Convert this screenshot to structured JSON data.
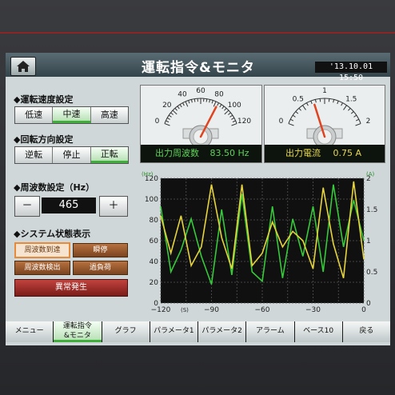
{
  "header": {
    "title": "運転指令&モニタ",
    "clock": "'13.10.01 15:50"
  },
  "speed": {
    "heading": "◆運転速度設定",
    "buttons": [
      "低速",
      "中速",
      "高速"
    ],
    "selected": 1
  },
  "direction": {
    "heading": "◆回転方向設定",
    "buttons": [
      "逆転",
      "停止",
      "正転"
    ],
    "selected": 2
  },
  "frequency": {
    "heading": "◆周波数設定（Hz）",
    "minus": "－",
    "value": "465",
    "plus": "＋"
  },
  "status": {
    "heading": "◆システム状態表示",
    "items": [
      "周波数到達",
      "瞬停",
      "周波数検出",
      "過負荷"
    ],
    "lit": [
      true,
      false,
      false,
      false
    ],
    "alarm": "異常発生"
  },
  "gauges": [
    {
      "ticks": [
        "0",
        "20",
        "40",
        "60",
        "80",
        "100",
        "120"
      ],
      "min": 0,
      "max": 120,
      "value": 83.5,
      "label": "出力周波数",
      "reading": "83.50 Hz",
      "text_color": "#5fd35a"
    },
    {
      "ticks": [
        "0",
        "0.5",
        "1",
        "1.5",
        "2"
      ],
      "min": 0,
      "max": 2,
      "value": 0.75,
      "label": "出力電流",
      "reading": "0.75 A",
      "text_color": "#e8d84a"
    }
  ],
  "chart_data": {
    "type": "line",
    "left_unit": "(Hz)",
    "right_unit": "(A)",
    "x_unit": "(S)",
    "x_ticks": [
      "−120",
      "−90",
      "−60",
      "−30",
      "0"
    ],
    "y_left_ticks": [
      "0",
      "20",
      "40",
      "60",
      "80",
      "100",
      "120"
    ],
    "y_right_ticks": [
      "0",
      "0.5",
      "1",
      "1.5",
      "2"
    ],
    "xlim": [
      -120,
      0
    ],
    "ylim_left": [
      0,
      120
    ],
    "ylim_right": [
      0,
      2
    ],
    "grid": true,
    "series": [
      {
        "color": "#36c93a",
        "axis": "right",
        "x": [
          -120,
          -114,
          -108,
          -102,
          -96,
          -90,
          -84,
          -78,
          -72,
          -66,
          -60,
          -54,
          -48,
          -42,
          -36,
          -30,
          -24,
          -18,
          -12,
          -6,
          0
        ],
        "values": [
          1.55,
          0.5,
          0.85,
          1.35,
          0.75,
          0.3,
          1.5,
          0.45,
          1.75,
          0.5,
          0.35,
          1.55,
          0.4,
          1.35,
          0.75,
          1.55,
          0.5,
          1.9,
          0.9,
          1.65,
          1.0
        ]
      },
      {
        "color": "#e6d43a",
        "axis": "right",
        "x": [
          -120,
          -114,
          -108,
          -102,
          -96,
          -90,
          -84,
          -78,
          -72,
          -66,
          -60,
          -54,
          -48,
          -42,
          -36,
          -30,
          -24,
          -18,
          -12,
          -6,
          0
        ],
        "values": [
          1.4,
          0.8,
          1.4,
          0.6,
          0.9,
          1.9,
          1.05,
          0.55,
          1.9,
          0.6,
          0.8,
          1.3,
          0.9,
          1.15,
          1.0,
          0.55,
          1.85,
          0.95,
          0.4,
          1.95,
          0.7
        ]
      }
    ]
  },
  "tabs": [
    "メニュー",
    "運転指令&モニタ",
    "グラフ",
    "パラメータ1",
    "パラメータ2",
    "アラーム",
    "ベース10",
    "戻る"
  ],
  "tab_sel_lines": [
    "運転指令",
    "&モニタ"
  ],
  "selected_tab": 1
}
